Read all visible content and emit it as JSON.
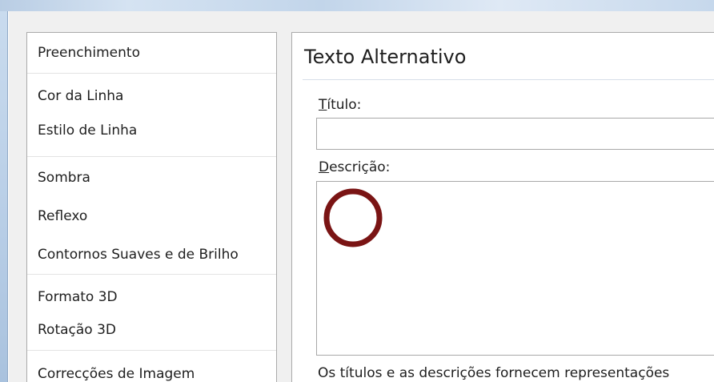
{
  "categories": [
    {
      "items": [
        {
          "label": "Preenchimento"
        }
      ]
    },
    {
      "items": [
        {
          "label": "Cor da Linha"
        },
        {
          "label": "Estilo de Linha"
        }
      ]
    },
    {
      "items": [
        {
          "label": "Sombra"
        },
        {
          "label": "Reflexo"
        },
        {
          "label": "Contornos Suaves e de Brilho"
        }
      ]
    },
    {
      "items": [
        {
          "label": "Formato 3D"
        },
        {
          "label": "Rotação 3D"
        }
      ]
    },
    {
      "items": [
        {
          "label": "Correcções de Imagem"
        }
      ]
    }
  ],
  "content": {
    "heading": "Texto Alternativo",
    "title_field": {
      "access_key": "T",
      "label_rest": "ítulo:",
      "value": ""
    },
    "description_field": {
      "access_key": "D",
      "label_rest": "escrição:",
      "value": ""
    },
    "help_text": "Os títulos e as descrições fornecem representações"
  },
  "colors": {
    "marker": "#7a1414"
  }
}
